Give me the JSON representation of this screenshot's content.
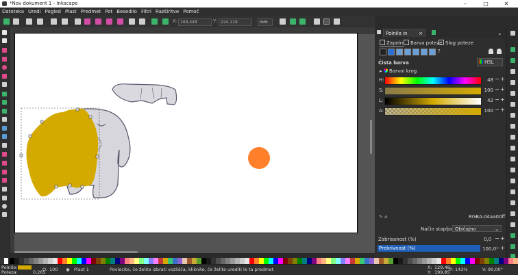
{
  "window": {
    "title": "*Nov dokument 1 - Inkscape"
  },
  "menu": [
    "Datoteka",
    "Uredi",
    "Pogled",
    "Plast",
    "Predmet",
    "Pot",
    "Besedilo",
    "Filtri",
    "Razširitve",
    "Pomoč"
  ],
  "toolcontrols": {
    "x_value": "169,448",
    "y_value": "224,118",
    "unit": "mm"
  },
  "panel": {
    "tab_title": "Polnilo in poteza",
    "subtabs": [
      "Zapolni",
      "Barva poteze",
      "Slog poteze"
    ],
    "flat_color_label": "Čista barva",
    "color_mode": "HSL",
    "color_wheel_label": "Barvni krog",
    "sliders": [
      {
        "label": "H:",
        "value": "48"
      },
      {
        "label": "S:",
        "value": "100"
      },
      {
        "label": "L:",
        "value": "42"
      },
      {
        "label": "A:",
        "value": "100"
      }
    ],
    "rgba_label": "RGBA:",
    "rgba_value": "d4aa00ff",
    "blend_label": "Način stapljanja:",
    "blend_value": "Običajno",
    "blur_label": "Zabrisanost (%)",
    "blur_value": "0,0",
    "opacity_label": "Prekrivnost (%)",
    "opacity_value": "100,0"
  },
  "status": {
    "fill_label": "Polnilo:",
    "stroke_label": "Poteza:",
    "stroke_width": "0,265",
    "opacity_label": "O:",
    "opacity_value": "100",
    "layer": "Plast 1",
    "message": "Povlecite, če želite izbrati vozlišča, kliknite, če želite urediti le ta predmet",
    "x_label": "X:",
    "x_value": "129,48",
    "y_label": "Y:",
    "y_value": "199,85",
    "zoom_label": "P:",
    "zoom_value": "143%",
    "rotation_label": "V:",
    "rotation_value": "90,00°"
  },
  "colors": {
    "fill": "#d4aa00",
    "orange_circle": "#ff7f2a",
    "accent_blue": "#2a6fd6",
    "opacity_bar": "#1f5fb8"
  },
  "icons": [
    "select-tool-icon",
    "node-tool-icon",
    "rectangle-tool-icon",
    "ellipse-tool-icon",
    "star-tool-icon",
    "pen-tool-icon",
    "text-tool-icon",
    "gradient-tool-icon",
    "dropper-tool-icon",
    "zoom-tool-icon"
  ]
}
